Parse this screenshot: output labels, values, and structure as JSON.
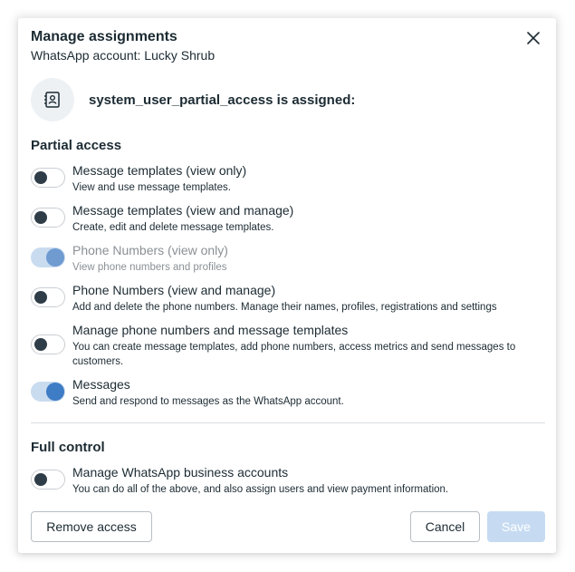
{
  "dialog": {
    "title": "Manage assignments",
    "subtitle": "WhatsApp account: Lucky Shrub",
    "close_icon": "close-icon"
  },
  "assignee": {
    "icon": "id-badge-icon",
    "text": "system_user_partial_access is assigned:"
  },
  "partial_access": {
    "title": "Partial access",
    "items": [
      {
        "label": "Message templates (view only)",
        "description": "View and use message templates.",
        "enabled": false,
        "disabled": false
      },
      {
        "label": "Message templates (view and manage)",
        "description": "Create, edit and delete message templates.",
        "enabled": false,
        "disabled": false
      },
      {
        "label": "Phone Numbers (view only)",
        "description": "View phone numbers and profiles",
        "enabled": true,
        "disabled": true
      },
      {
        "label": "Phone Numbers (view and manage)",
        "description": "Add and delete the phone numbers. Manage their names, profiles, registrations and settings",
        "enabled": false,
        "disabled": false
      },
      {
        "label": "Manage phone numbers and message templates",
        "description": "You can create message templates, add phone numbers, access metrics and send messages to customers.",
        "enabled": false,
        "disabled": false
      },
      {
        "label": "Messages",
        "description": "Send and respond to messages as the WhatsApp account.",
        "enabled": true,
        "disabled": false
      }
    ]
  },
  "full_control": {
    "title": "Full control",
    "items": [
      {
        "label": "Manage WhatsApp business accounts",
        "description": "You can do all of the above, and also assign users and view payment information.",
        "enabled": false,
        "disabled": false
      }
    ]
  },
  "footer": {
    "remove_label": "Remove access",
    "cancel_label": "Cancel",
    "save_label": "Save"
  },
  "colors": {
    "accent": "#3e7cc5",
    "accent_light": "#c9dbef",
    "save_disabled": "#c6dbf2",
    "text": "#1c2b33"
  }
}
